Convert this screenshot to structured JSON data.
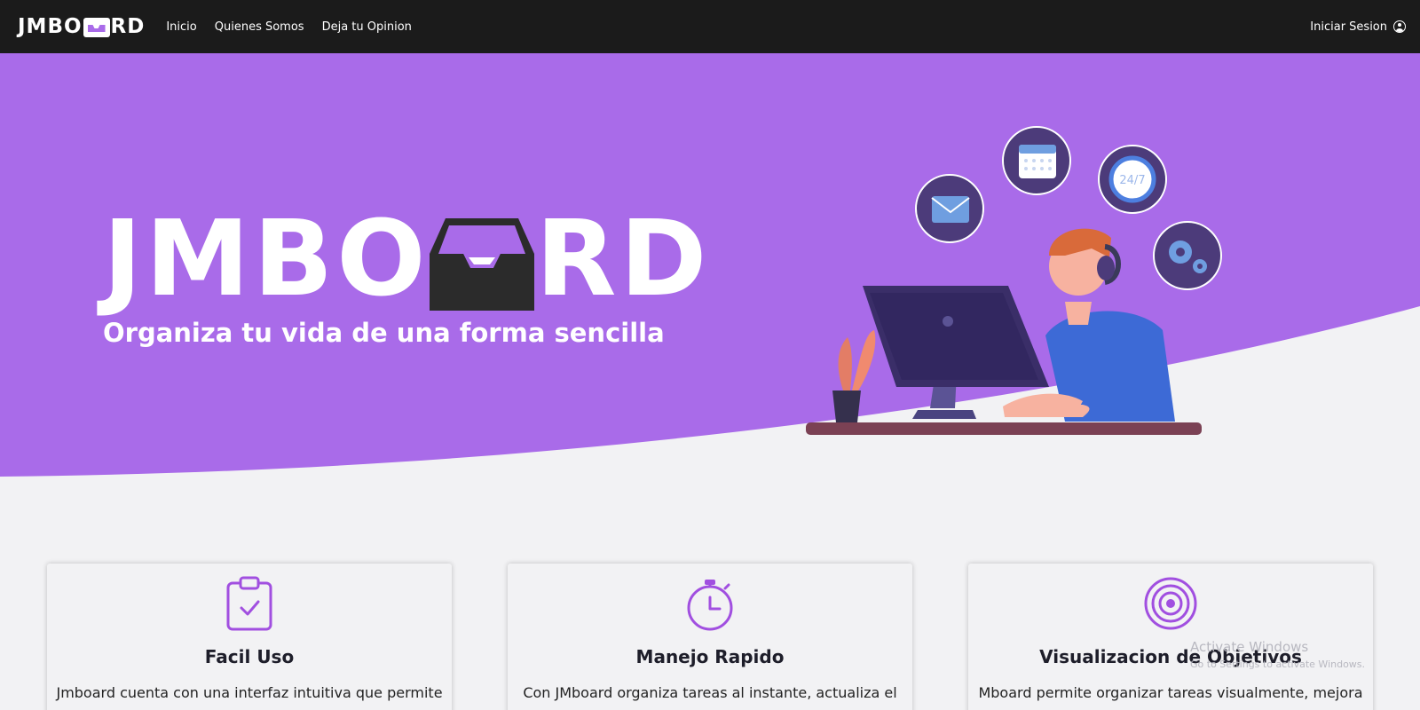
{
  "navbar": {
    "brand_part1": "JMBO",
    "brand_part2": "RD",
    "links": [
      "Inicio",
      "Quienes Somos",
      "Deja tu Opinion"
    ],
    "login_label": "Iniciar Sesion"
  },
  "hero": {
    "logo_part1": "JMBO",
    "logo_part2": "RD",
    "tagline": "Organiza tu vida de una forma sencilla",
    "clock_label": "24/7",
    "background_color": "#a96be9"
  },
  "features": [
    {
      "icon": "clipboard-check-icon",
      "title": "Facil Uso",
      "text": "Jmboard cuenta con una interfaz intuitiva que permite"
    },
    {
      "icon": "stopwatch-icon",
      "title": "Manejo Rapido",
      "text": "Con JMboard organiza tareas al instante, actualiza el"
    },
    {
      "icon": "target-icon",
      "title": "Visualizacion de Objetivos",
      "text": "Mboard permite organizar tareas visualmente, mejora"
    }
  ],
  "watermark": {
    "title": "Activate Windows",
    "subtitle": "Go to Settings to activate Windows."
  },
  "colors": {
    "accent": "#a96be9",
    "nav": "#1b1b1b",
    "page": "#f2f2f4"
  }
}
